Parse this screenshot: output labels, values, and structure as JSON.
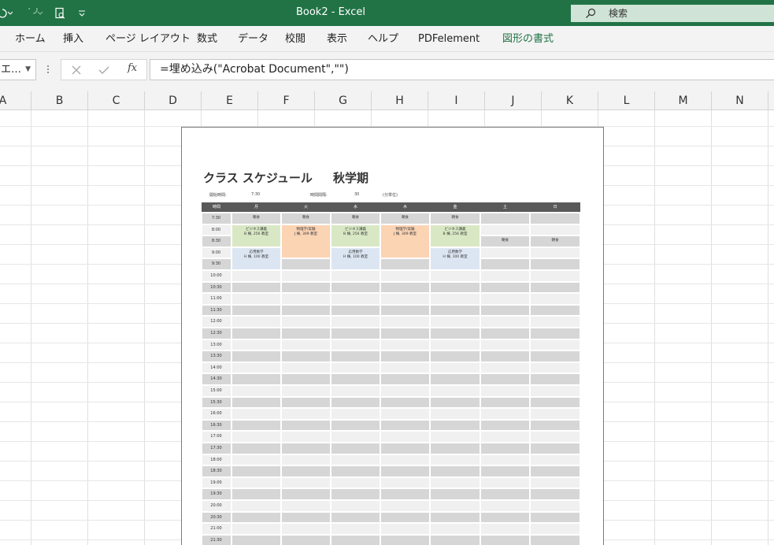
{
  "titlebar": {
    "doc_title": "Book2  -  Excel",
    "search_placeholder": "検索",
    "bg_color": "#217346"
  },
  "ribbon": {
    "tabs": [
      "ホーム",
      "挿入",
      "ページ レイアウト",
      "数式",
      "データ",
      "校閲",
      "表示",
      "ヘルプ",
      "PDFelement",
      "図形の書式"
    ]
  },
  "formula_bar": {
    "name_box": "エ…",
    "formula": "=埋め込み(\"Acrobat Document\",\"\")",
    "fx_label": "fx"
  },
  "columns": [
    "A",
    "B",
    "C",
    "D",
    "E",
    "F",
    "G",
    "H",
    "I",
    "J",
    "K",
    "L",
    "M",
    "N"
  ],
  "embedded_doc": {
    "title": "クラス スケジュール",
    "term": "秋学期",
    "start_time_label": "開始時間:",
    "start_time": "7:30",
    "interval_label": "時間間隔:",
    "interval": "30",
    "interval_unit": "(分単位)",
    "days": [
      "時間",
      "月",
      "火",
      "水",
      "木",
      "金",
      "土",
      "日"
    ],
    "times": [
      "7:30",
      "8:00",
      "8:30",
      "9:00",
      "9:30",
      "10:00",
      "10:30",
      "11:00",
      "11:30",
      "12:00",
      "12:30",
      "13:00",
      "13:30",
      "14:00",
      "14:30",
      "15:00",
      "15:30",
      "16:00",
      "16:30",
      "17:00",
      "17:30",
      "18:00",
      "18:30",
      "19:00",
      "19:30",
      "20:00",
      "20:30",
      "21:00",
      "21:30"
    ],
    "breakfast": "朝食",
    "events": [
      {
        "day": 1,
        "start": 1,
        "span": 2,
        "line1": "ビジネス講義",
        "line2": "B 棟, 256 教室",
        "color": "#d9e8c4"
      },
      {
        "day": 1,
        "start": 3,
        "span": 2,
        "line1": "応用数学",
        "line2": "H 棟, 100 教室",
        "color": "#dce6f2"
      },
      {
        "day": 2,
        "start": 1,
        "span": 3,
        "line1": "物理学/実験",
        "line2": "J 棟, 309 教室",
        "color": "#fbd4b4"
      },
      {
        "day": 3,
        "start": 1,
        "span": 2,
        "line1": "ビジネス講義",
        "line2": "B 棟, 256 教室",
        "color": "#d9e8c4"
      },
      {
        "day": 3,
        "start": 3,
        "span": 2,
        "line1": "応用数学",
        "line2": "H 棟, 100 教室",
        "color": "#dce6f2"
      },
      {
        "day": 4,
        "start": 1,
        "span": 3,
        "line1": "物理学/実験",
        "line2": "J 棟, 309 教室",
        "color": "#fbd4b4"
      },
      {
        "day": 5,
        "start": 1,
        "span": 2,
        "line1": "ビジネス講義",
        "line2": "B 棟, 256 教室",
        "color": "#d9e8c4"
      },
      {
        "day": 5,
        "start": 3,
        "span": 2,
        "line1": "応用数学",
        "line2": "H 棟, 100 教室",
        "color": "#dce6f2"
      }
    ]
  }
}
